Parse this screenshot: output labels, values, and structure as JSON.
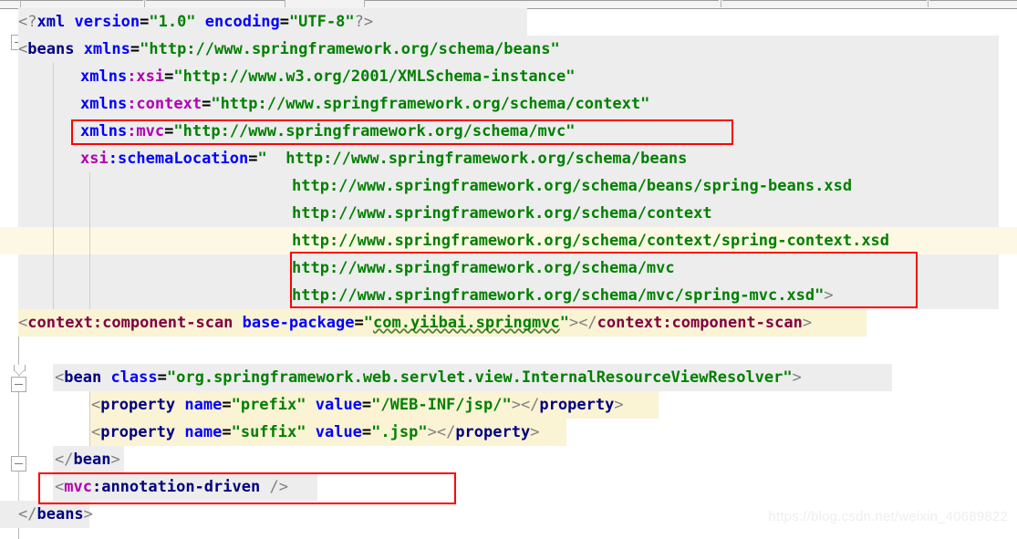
{
  "app": {
    "kind": "xml-code-editor",
    "watermark": "https://blog.csdn.net/weixin_40689822"
  },
  "tabstrip": {
    "separator_positions": [
      22,
      158,
      312,
      400,
      790,
      1018,
      1175,
      1340
    ]
  },
  "gutter": {
    "bulb_icon": "lightbulb-intention-icon",
    "fold_markers": [
      {
        "row": 1,
        "type": "collapse"
      },
      {
        "row": 11,
        "type": "collapse"
      },
      {
        "row": 14,
        "type": "collapse"
      },
      {
        "row": 17,
        "type": "collapse"
      }
    ]
  },
  "code": {
    "language": "xml",
    "lines": [
      {
        "n": 0,
        "indent": 0,
        "bg": "white",
        "text": "<?xml version=\"1.0\" encoding=\"UTF-8\"?>"
      },
      {
        "n": 1,
        "indent": 0,
        "bg": "gray",
        "text": "<beans xmlns=\"http://www.springframework.org/schema/beans\""
      },
      {
        "n": 2,
        "indent": 7,
        "bg": "gray",
        "text": "xmlns:xsi=\"http://www.w3.org/2001/XMLSchema-instance\""
      },
      {
        "n": 3,
        "indent": 7,
        "bg": "gray",
        "text": "xmlns:context=\"http://www.springframework.org/schema/context\""
      },
      {
        "n": 4,
        "indent": 7,
        "bg": "gray",
        "text": "xmlns:mvc=\"http://www.springframework.org/schema/mvc\""
      },
      {
        "n": 5,
        "indent": 7,
        "bg": "gray",
        "text": "xsi:schemaLocation=\"  http://www.springframework.org/schema/beans"
      },
      {
        "n": 6,
        "indent": 28,
        "bg": "gray",
        "text": "http://www.springframework.org/schema/beans/spring-beans.xsd"
      },
      {
        "n": 7,
        "indent": 28,
        "bg": "gray",
        "text": "http://www.springframework.org/schema/context"
      },
      {
        "n": 8,
        "indent": 28,
        "bg": "current",
        "text": "http://www.springframework.org/schema/context/spring-context.xsd"
      },
      {
        "n": 9,
        "indent": 28,
        "bg": "gray",
        "text": "http://www.springframework.org/schema/mvc"
      },
      {
        "n": 10,
        "indent": 28,
        "bg": "gray",
        "text": "http://www.springframework.org/schema/mvc/spring-mvc.xsd\">"
      },
      {
        "n": 11,
        "indent": 0,
        "bg": "cream",
        "text": "<context:component-scan base-package=\"com.yiibai.springmvc\"></context:component-scan>"
      },
      {
        "n": 12,
        "indent": 0,
        "bg": "white",
        "text": ""
      },
      {
        "n": 13,
        "indent": 0,
        "bg": "white",
        "text": ""
      },
      {
        "n": 14,
        "indent": 4,
        "bg": "gray",
        "text": "<bean class=\"org.springframework.web.servlet.view.InternalResourceViewResolver\">"
      },
      {
        "n": 15,
        "indent": 8,
        "bg": "cream",
        "text": "<property name=\"prefix\" value=\"/WEB-INF/jsp/\"></property>"
      },
      {
        "n": 16,
        "indent": 8,
        "bg": "cream",
        "text": "<property name=\"suffix\" value=\".jsp\"></property>"
      },
      {
        "n": 17,
        "indent": 4,
        "bg": "gray",
        "text": "</bean>"
      },
      {
        "n": 18,
        "indent": 4,
        "bg": "gray",
        "text": "<mvc:annotation-driven />"
      },
      {
        "n": 19,
        "indent": 0,
        "bg": "gray",
        "text": "</beans>"
      }
    ],
    "warning_underline": "com.yiibai.springmvc"
  },
  "annotations": {
    "red_boxes": [
      {
        "label": "xmlns-mvc-highlight",
        "target": "xmlns:mvc=\"http://www.springframework.org/schema/mvc\""
      },
      {
        "label": "mvc-schema-location-highlight",
        "target": "http://www.springframework.org/schema/mvc  http://www.springframework.org/schema/mvc/spring-mvc.xsd"
      },
      {
        "label": "mvc-annotation-driven-highlight",
        "target": "<mvc:annotation-driven />"
      }
    ]
  },
  "colors": {
    "tag": "#000080",
    "namespace_prefix": "#b000b0",
    "attribute": "#0000ff",
    "value": "#008000",
    "custom_tag": "#800040",
    "punct": "#808080",
    "highlight_box": "#ff0000",
    "row_gray": "#ededed",
    "row_cream": "#faf3d4",
    "row_current": "#fdf8e3"
  }
}
